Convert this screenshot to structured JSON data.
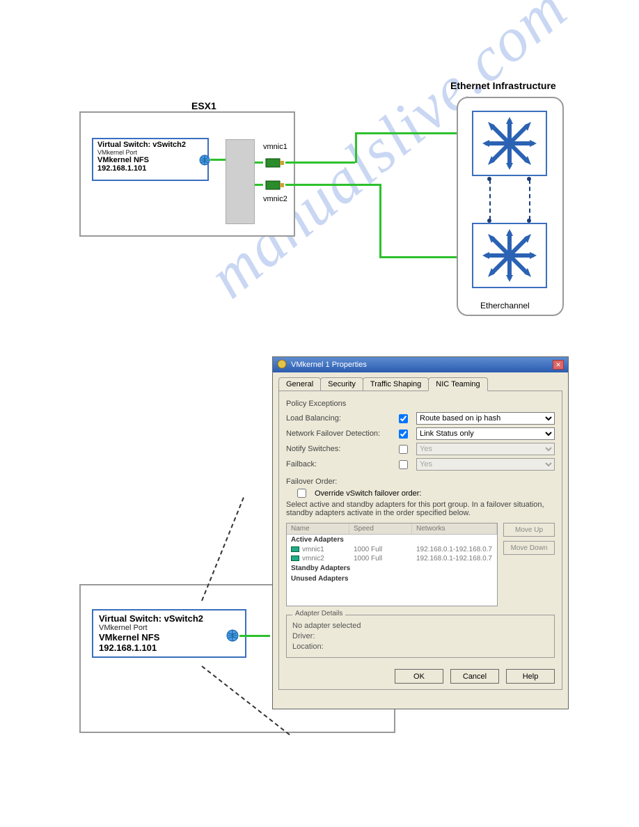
{
  "top": {
    "esx_label": "ESX1",
    "vswitch": {
      "title": "Virtual Switch: vSwitch2",
      "port_label": "VMkernel Port",
      "name": "VMkernel NFS",
      "ip": "192.168.1.101"
    },
    "nic1": "vmnic1",
    "nic2": "vmnic2",
    "ethernet_title": "Ethernet Infrastructure",
    "etherchannel": "Etherchannel"
  },
  "bottom": {
    "vswitch": {
      "title": "Virtual Switch: vSwitch2",
      "port_label": "VMkernel Port",
      "name": "VMkernel NFS",
      "ip": "192.168.1.101"
    }
  },
  "dialog": {
    "title": "VMkernel 1 Properties",
    "tabs": {
      "general": "General",
      "security": "Security",
      "traffic": "Traffic Shaping",
      "nic": "NIC Teaming"
    },
    "policy_exceptions_label": "Policy Exceptions",
    "load_balancing": {
      "label": "Load Balancing:",
      "value": "Route based on ip hash"
    },
    "network_failover": {
      "label": "Network Failover Detection:",
      "value": "Link Status only"
    },
    "notify_switches": {
      "label": "Notify Switches:",
      "value": "Yes"
    },
    "failback": {
      "label": "Failback:",
      "value": "Yes"
    },
    "failover_order_label": "Failover Order:",
    "override_label": "Override vSwitch failover order:",
    "failover_desc": "Select active and standby adapters for this port group.  In a failover situation, standby adapters activate  in the order specified below.",
    "columns": {
      "name": "Name",
      "speed": "Speed",
      "networks": "Networks"
    },
    "sections": {
      "active": "Active Adapters",
      "standby": "Standby Adapters",
      "unused": "Unused Adapters"
    },
    "adapters": [
      {
        "name": "vmnic1",
        "speed": "1000 Full",
        "networks": "192.168.0.1-192.168.0.7"
      },
      {
        "name": "vmnic2",
        "speed": "1000 Full",
        "networks": "192.168.0.1-192.168.0.7"
      }
    ],
    "move_up": "Move Up",
    "move_down": "Move Down",
    "adapter_details": {
      "legend": "Adapter Details",
      "no_selected": "No adapter selected",
      "driver": "Driver:",
      "location": "Location:"
    },
    "footer": {
      "ok": "OK",
      "cancel": "Cancel",
      "help": "Help"
    }
  }
}
